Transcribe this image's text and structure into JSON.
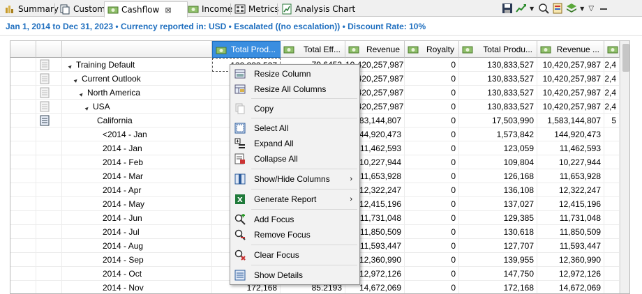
{
  "tabs": [
    {
      "label": "Summary",
      "icon": "summary-icon",
      "active": false
    },
    {
      "label": "Custom",
      "icon": "custom-icon",
      "active": false
    },
    {
      "label": "Cashflow",
      "icon": "cashflow-icon",
      "active": true
    },
    {
      "label": "Income",
      "icon": "income-icon",
      "active": false
    },
    {
      "label": "Metrics",
      "icon": "metrics-icon",
      "active": false
    },
    {
      "label": "Analysis Chart",
      "icon": "analysis-chart-icon",
      "active": false
    }
  ],
  "tab_close_glyph": "⊠",
  "info": {
    "text": "Jan 1, 2014 to Dec 31, 2023 • Currency reported in: USD • Escalated ((no escalation)) • Discount Rate: 10%"
  },
  "columns": [
    {
      "label": "Total Prod...",
      "selected": true
    },
    {
      "label": "Total Eff...",
      "selected": false
    },
    {
      "label": "Revenue",
      "selected": false
    },
    {
      "label": "Royalty",
      "selected": false
    },
    {
      "label": "Total Produ...",
      "selected": false
    },
    {
      "label": "Revenue ...",
      "selected": false
    },
    {
      "label": "",
      "selected": false
    }
  ],
  "rows": [
    {
      "label": "Training Default",
      "indent": 0,
      "expand": "▲",
      "c1": "130,833,527",
      "c2": "79.6453",
      "c3": "10,420,257,987",
      "c4": "0",
      "c5": "130,833,527",
      "c6": "10,420,257,987",
      "c7": "2,4"
    },
    {
      "label": "Current Outlook",
      "indent": 1,
      "expand": "▲",
      "c1": "",
      "c2": "",
      "c3": "10,420,257,987",
      "c4": "0",
      "c5": "130,833,527",
      "c6": "10,420,257,987",
      "c7": "2,4"
    },
    {
      "label": "North America",
      "indent": 2,
      "expand": "▲",
      "c1": "",
      "c2": "",
      "c3": "10,420,257,987",
      "c4": "0",
      "c5": "130,833,527",
      "c6": "10,420,257,987",
      "c7": "2,4"
    },
    {
      "label": "USA",
      "indent": 3,
      "expand": "▲",
      "c1": "",
      "c2": "",
      "c3": "10,420,257,987",
      "c4": "0",
      "c5": "130,833,527",
      "c6": "10,420,257,987",
      "c7": "2,4"
    },
    {
      "label": "California",
      "indent": 4,
      "expand": "",
      "c1": "",
      "c2": "",
      "c3": "1,583,144,807",
      "c4": "0",
      "c5": "17,503,990",
      "c6": "1,583,144,807",
      "c7": "5"
    },
    {
      "label": "<2014 - Jan",
      "indent": 5,
      "expand": "",
      "c1": "",
      "c2": "",
      "c3": "144,920,473",
      "c4": "0",
      "c5": "1,573,842",
      "c6": "144,920,473",
      "c7": ""
    },
    {
      "label": "2014 - Jan",
      "indent": 5,
      "expand": "",
      "c1": "",
      "c2": "",
      "c3": "11,462,593",
      "c4": "0",
      "c5": "123,059",
      "c6": "11,462,593",
      "c7": ""
    },
    {
      "label": "2014 - Feb",
      "indent": 5,
      "expand": "",
      "c1": "",
      "c2": "",
      "c3": "10,227,944",
      "c4": "0",
      "c5": "109,804",
      "c6": "10,227,944",
      "c7": ""
    },
    {
      "label": "2014 - Mar",
      "indent": 5,
      "expand": "",
      "c1": "",
      "c2": "",
      "c3": "11,653,928",
      "c4": "0",
      "c5": "126,168",
      "c6": "11,653,928",
      "c7": ""
    },
    {
      "label": "2014 - Apr",
      "indent": 5,
      "expand": "",
      "c1": "",
      "c2": "",
      "c3": "12,322,247",
      "c4": "0",
      "c5": "136,108",
      "c6": "12,322,247",
      "c7": ""
    },
    {
      "label": "2014 - May",
      "indent": 5,
      "expand": "",
      "c1": "",
      "c2": "",
      "c3": "12,415,196",
      "c4": "0",
      "c5": "137,027",
      "c6": "12,415,196",
      "c7": ""
    },
    {
      "label": "2014 - Jun",
      "indent": 5,
      "expand": "",
      "c1": "",
      "c2": "",
      "c3": "11,731,048",
      "c4": "0",
      "c5": "129,385",
      "c6": "11,731,048",
      "c7": ""
    },
    {
      "label": "2014 - Jul",
      "indent": 5,
      "expand": "",
      "c1": "",
      "c2": "",
      "c3": "11,850,509",
      "c4": "0",
      "c5": "130,618",
      "c6": "11,850,509",
      "c7": ""
    },
    {
      "label": "2014 - Aug",
      "indent": 5,
      "expand": "",
      "c1": "",
      "c2": "",
      "c3": "11,593,447",
      "c4": "0",
      "c5": "127,707",
      "c6": "11,593,447",
      "c7": ""
    },
    {
      "label": "2014 - Sep",
      "indent": 5,
      "expand": "",
      "c1": "",
      "c2": "",
      "c3": "12,360,990",
      "c4": "0",
      "c5": "139,955",
      "c6": "12,360,990",
      "c7": ""
    },
    {
      "label": "2014 - Oct",
      "indent": 5,
      "expand": "",
      "c1": "",
      "c2": "",
      "c3": "12,972,126",
      "c4": "0",
      "c5": "147,750",
      "c6": "12,972,126",
      "c7": ""
    },
    {
      "label": "2014 - Nov",
      "indent": 5,
      "expand": "",
      "c1": "172,168",
      "c2": "85.2193",
      "c3": "14,672,069",
      "c4": "0",
      "c5": "172,168",
      "c6": "14,672,069",
      "c7": ""
    }
  ],
  "menu": {
    "items": [
      {
        "label": "Resize Column",
        "icon": "resize-column-icon",
        "submenu": false
      },
      {
        "label": "Resize All Columns",
        "icon": "resize-all-columns-icon",
        "submenu": false
      },
      {
        "label": "Copy",
        "icon": "copy-icon",
        "submenu": false
      },
      {
        "label": "Select All",
        "icon": "select-all-icon",
        "submenu": false
      },
      {
        "label": "Expand All",
        "icon": "expand-all-icon",
        "submenu": false
      },
      {
        "label": "Collapse All",
        "icon": "collapse-all-icon",
        "submenu": false
      },
      {
        "label": "Show/Hide Columns",
        "icon": "show-hide-columns-icon",
        "submenu": true
      },
      {
        "label": "Generate Report",
        "icon": "generate-report-icon",
        "submenu": true
      },
      {
        "label": "Add Focus",
        "icon": "add-focus-icon",
        "submenu": false
      },
      {
        "label": "Remove Focus",
        "icon": "remove-focus-icon",
        "submenu": false
      },
      {
        "label": "Clear Focus",
        "icon": "clear-focus-icon",
        "submenu": false
      },
      {
        "label": "Show Details",
        "icon": "show-details-icon",
        "submenu": false
      }
    ],
    "submenu_arrow": "›"
  },
  "colors": {
    "accent": "#1f6fbf",
    "header_selected": "#3a8ee0"
  }
}
